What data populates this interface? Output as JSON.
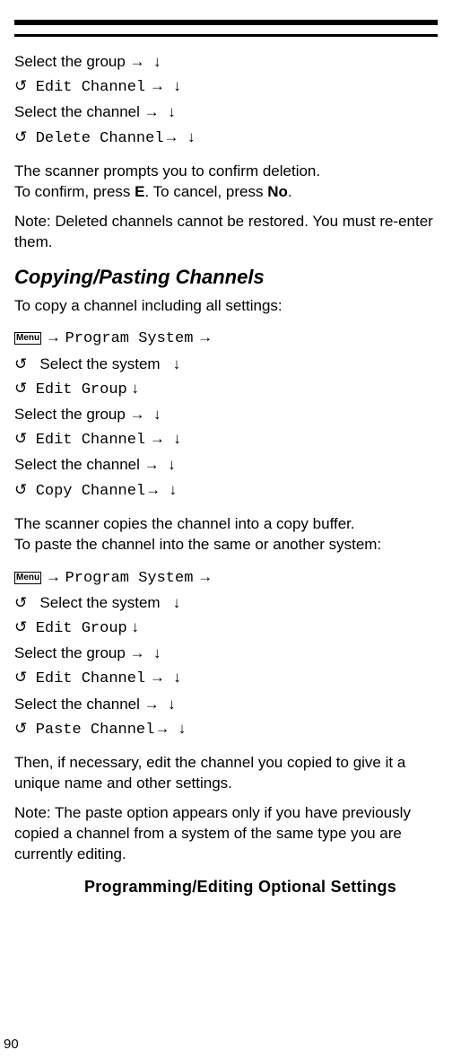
{
  "menuLabel": "Menu",
  "icons": {
    "rotate": "↺",
    "right": "→",
    "down": "↓",
    "downThin": "↓"
  },
  "intro": {
    "line1_pre": "Select the group ",
    "line2_code": "Edit Channel",
    "line3_pre": "Select the channel ",
    "line4_code": "Delete Channel"
  },
  "deletePrompt_l1": "The scanner prompts you to confirm deletion.",
  "deletePrompt_l2a": "To confirm, press ",
  "deletePrompt_E": "E",
  "deletePrompt_l2b": ". To cancel, press ",
  "deletePrompt_No": "No",
  "deletePrompt_l2c": ".",
  "noteDeleted": "Note: Deleted channels cannot be restored. You must re-enter them.",
  "heading_copy": "Copying/Pasting Channels",
  "copy_intro": "To copy a channel including all settings:",
  "copyNav": {
    "programSystem": "Program System",
    "selectSystem": "Select the system",
    "editGroup": "Edit Group",
    "selectGroup": "Select the group",
    "editChannel": "Edit Channel",
    "selectChannel": "Select the channel",
    "copyChannel": "Copy Channel"
  },
  "copyBuffer_l1": "The scanner copies the channel into a copy buffer.",
  "copyBuffer_l2": "To paste the channel into the same or another system:",
  "pasteNav": {
    "programSystem": "Program System",
    "selectSystem": "Select the system",
    "editGroup": "Edit Group",
    "selectGroup": "Select the group",
    "editChannel": "Edit Channel",
    "selectChannel": "Select the channel",
    "pasteChannel": "Paste Channel"
  },
  "thenEdit": "Then, if necessary, edit the channel you copied to give it a  unique name and other settings.",
  "notePaste": "Note: The paste option appears only if you have previously copied a channel from a system of the same type you are currently editing.",
  "sectionHeading": "Programming/Editing Optional Settings",
  "pageNumber": "90"
}
